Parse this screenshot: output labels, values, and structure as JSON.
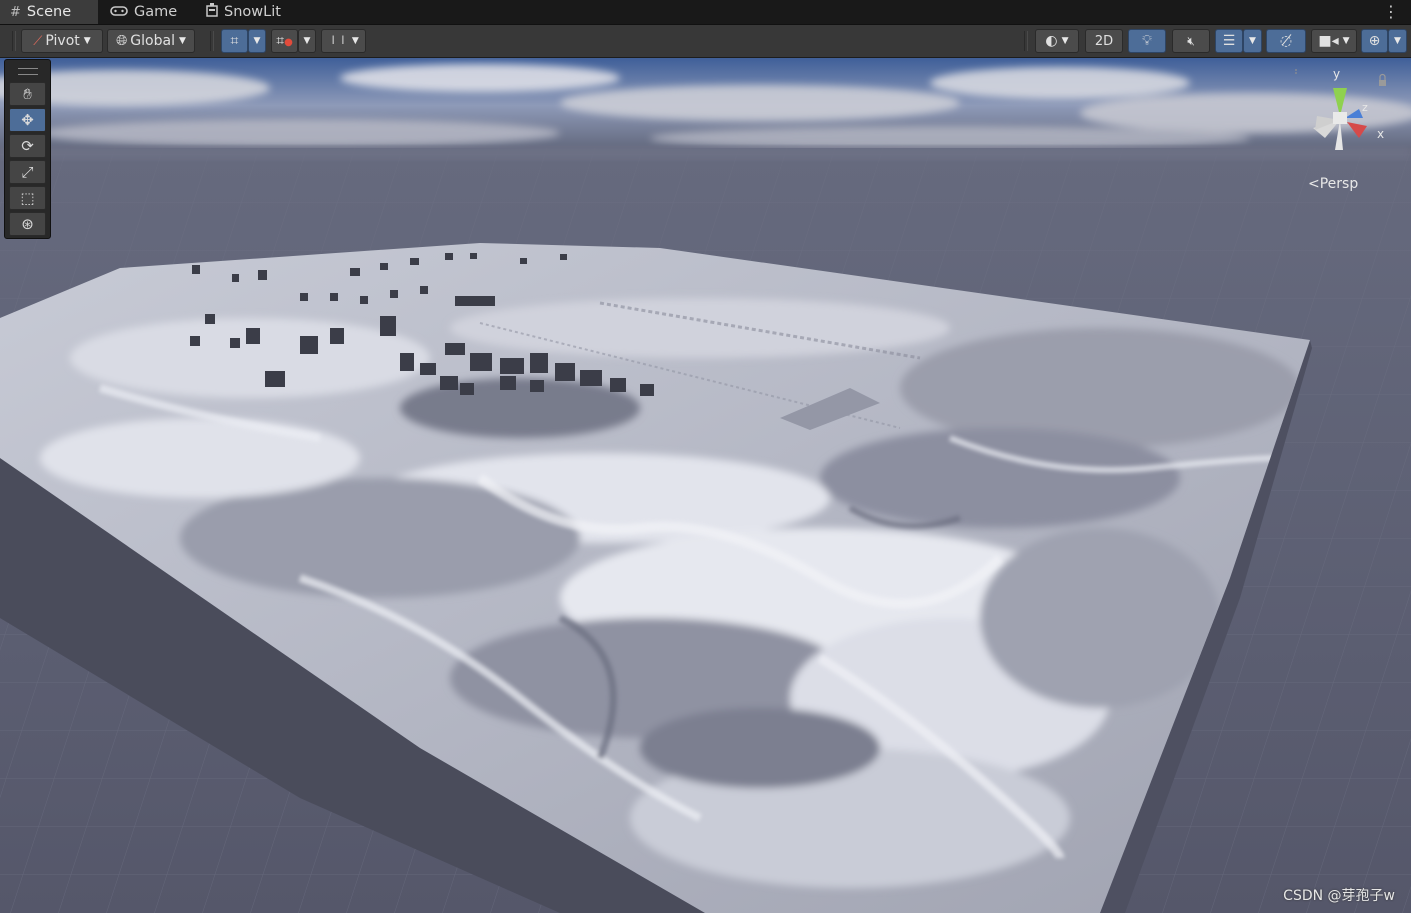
{
  "tabs": [
    {
      "label": "Scene",
      "icon": "grid-icon",
      "active": true
    },
    {
      "label": "Game",
      "icon": "gamepad-icon",
      "active": false
    },
    {
      "label": "SnowLit",
      "icon": "hierarchy-icon",
      "active": false
    }
  ],
  "toolbar": {
    "pivot_label": "Pivot",
    "global_label": "Global",
    "mode_2d_label": "2D"
  },
  "tools": [
    "hand-tool",
    "move-tool",
    "rotate-tool",
    "scale-tool",
    "rect-tool",
    "transform-tool"
  ],
  "selected_tool": "move-tool",
  "gizmo": {
    "axis_y": "y",
    "axis_z": "z",
    "axis_x": "x",
    "projection_label": "Persp"
  },
  "watermark": "CSDN @芽孢子w",
  "colors": {
    "accent_blue": "#4d6d98",
    "axis_x": "#d64a4a",
    "axis_y": "#8fd14f",
    "axis_z": "#4a7fd6",
    "snow": "#dfe1ea",
    "ground_grid": "#585a6a"
  }
}
